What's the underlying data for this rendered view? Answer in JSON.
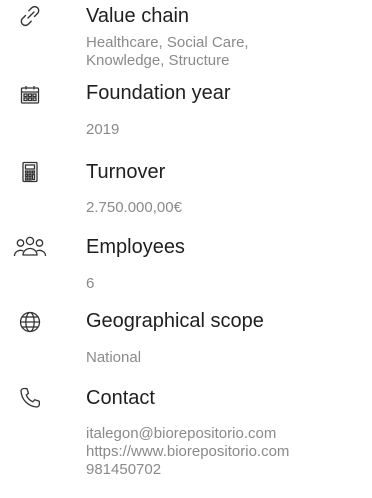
{
  "items": [
    {
      "icon": "link-icon",
      "title": "Value chain",
      "values": [
        "Healthcare, Social Care,",
        "Knowledge, Structure"
      ]
    },
    {
      "icon": "calendar-icon",
      "title": "Foundation year",
      "values": [
        "2019"
      ]
    },
    {
      "icon": "calculator-icon",
      "title": "Turnover",
      "values": [
        "2.750.000,00€"
      ]
    },
    {
      "icon": "people-icon",
      "title": "Employees",
      "values": [
        "6"
      ]
    },
    {
      "icon": "globe-icon",
      "title": "Geographical scope",
      "values": [
        "National"
      ]
    },
    {
      "icon": "phone-icon",
      "title": "Contact",
      "values": [
        "italegon@biorepositorio.com",
        "https://www.biorepositorio.com",
        "981450702"
      ]
    }
  ]
}
